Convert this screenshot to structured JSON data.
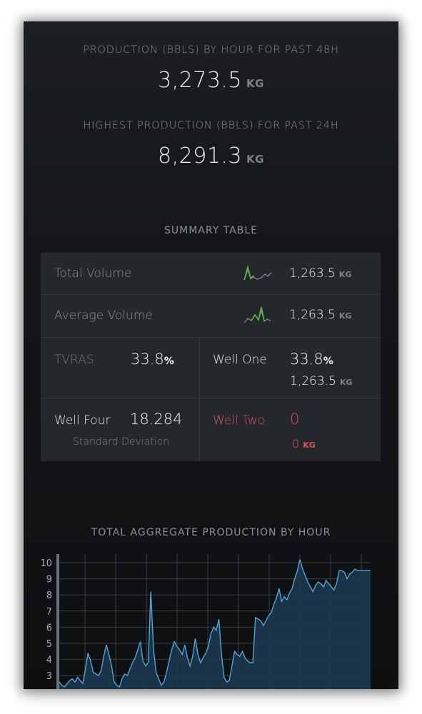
{
  "stats": {
    "production_label": "PRODUCTION (BBLS) BY HOUR FOR PAST 48H",
    "production_value": "3,273.5",
    "production_unit": "KG",
    "highest_label": "HIGHEST PRODUCTION (BBLS) FOR PAST 24H",
    "highest_value": "8,291.3",
    "highest_unit": "KG"
  },
  "summary": {
    "title": "SUMMARY TABLE",
    "rows": [
      {
        "label": "Total Volume",
        "value": "1,263.5",
        "unit": "KG",
        "spark_icon": "sparkline-icon"
      },
      {
        "label": "Average Volume",
        "value": "1,263.5",
        "unit": "KG",
        "spark_icon": "sparkline-icon"
      }
    ],
    "tvras": {
      "label": "TVRAS",
      "value": "33.8",
      "suffix": "%"
    },
    "well_one": {
      "label": "Well One",
      "value": "33.8",
      "suffix": "%",
      "sub_value": "1,263.5",
      "sub_unit": "KG"
    },
    "well_four": {
      "label": "Well Four",
      "value": "18.284",
      "sub_label": "Standard Deviation"
    },
    "well_two": {
      "label": "Well Two",
      "value": "0",
      "sub_value": "0",
      "sub_unit": "KG"
    }
  },
  "chart_data": {
    "type": "area",
    "title": "TOTAL AGGREGATE PRODUCTION BY HOUR",
    "xlabel": "",
    "ylabel": "",
    "ylim": [
      2.5,
      10.3
    ],
    "yticks": [
      3,
      4,
      5,
      6,
      7,
      8,
      9,
      10
    ],
    "grid": true,
    "colors": {
      "line": "#4fa6d6",
      "fill": "#1c3a52"
    },
    "x": [
      0,
      1,
      2,
      3,
      4,
      5,
      6,
      7,
      8,
      9,
      10,
      11,
      12,
      13,
      14,
      15,
      16,
      17,
      18,
      19,
      20,
      21,
      22,
      23,
      24,
      25,
      26,
      27,
      28,
      29,
      30,
      31,
      32,
      33,
      34,
      35,
      36,
      37,
      38,
      39,
      40,
      41,
      42,
      43,
      44,
      45,
      46,
      47,
      48,
      49,
      50,
      51,
      52,
      53,
      54,
      55,
      56,
      57,
      58,
      59,
      60,
      61,
      62,
      63,
      64,
      65,
      66,
      67,
      68,
      69,
      70,
      71,
      72,
      73,
      74,
      75,
      76,
      77,
      78,
      79,
      80,
      81,
      82,
      83,
      84,
      85,
      86,
      87,
      88,
      89,
      90,
      91,
      92,
      93,
      94,
      95,
      96,
      97,
      98,
      99,
      100,
      101,
      102,
      103,
      104,
      105,
      106,
      107,
      108,
      109,
      110,
      111,
      112,
      113,
      114,
      115,
      116,
      117,
      118,
      119
    ],
    "series": [
      {
        "values": [
          2.6,
          2.4,
          2.3,
          2.5,
          2.7,
          2.8,
          2.6,
          2.9,
          2.7,
          2.5,
          3.4,
          4.4,
          3.9,
          3.2,
          3.1,
          3.0,
          3.3,
          4.2,
          4.9,
          4.3,
          3.6,
          2.6,
          2.4,
          2.3,
          2.8,
          3.1,
          3.0,
          3.4,
          3.8,
          4.1,
          4.6,
          5.1,
          3.9,
          3.6,
          3.8,
          8.2,
          4.7,
          3.2,
          2.8,
          2.4,
          2.6,
          3.2,
          3.9,
          4.6,
          5.1,
          4.8,
          4.6,
          4.3,
          4.9,
          4.1,
          3.6,
          4.2,
          5.3,
          4.3,
          3.8,
          4.1,
          4.4,
          4.8,
          5.6,
          6.0,
          5.8,
          6.5,
          4.3,
          2.9,
          2.6,
          2.7,
          3.6,
          4.5,
          4.3,
          4.2,
          4.5,
          4.1,
          3.9,
          3.8,
          3.8,
          6.6,
          6.5,
          6.4,
          6.1,
          6.4,
          6.7,
          6.9,
          7.4,
          7.8,
          8.4,
          7.6,
          7.9,
          7.7,
          8.1,
          8.4,
          9.0,
          9.5,
          10.2,
          9.6,
          9.2,
          8.8,
          8.5,
          8.2,
          8.6,
          8.8,
          8.7,
          8.5,
          8.9,
          8.7,
          8.5,
          8.3,
          8.7,
          9.5,
          9.5,
          9.4,
          9.0,
          9.3,
          9.4,
          9.6,
          9.5,
          9.5,
          9.5,
          9.5,
          9.5,
          9.5
        ]
      }
    ]
  }
}
